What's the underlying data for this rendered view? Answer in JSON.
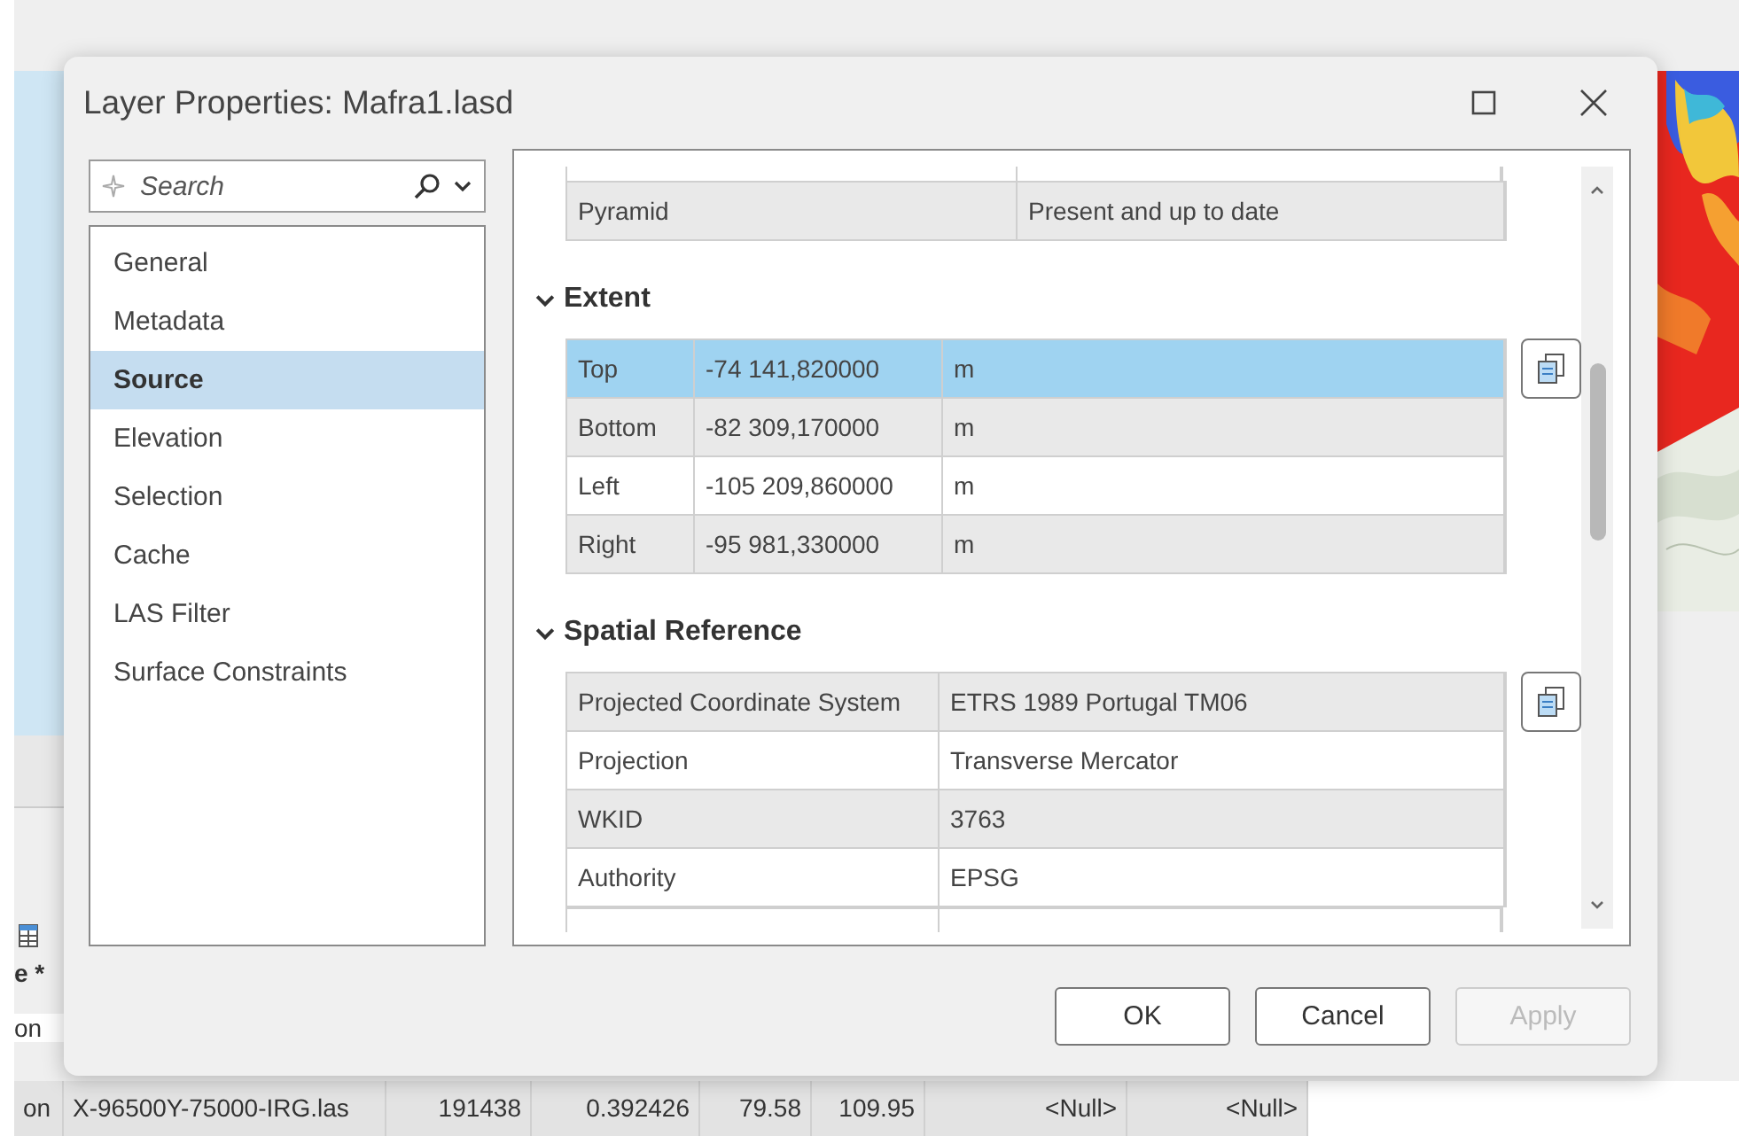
{
  "background": {
    "column_header": "e *",
    "row_label": "on",
    "table_row": [
      "on",
      "X-96500Y-75000-IRG.las",
      "191438",
      "0.392426",
      "79.58",
      "109.95",
      "<Null>",
      "<Null>"
    ]
  },
  "dialog": {
    "title": "Layer Properties: Mafra1.lasd",
    "search": {
      "placeholder": "Search"
    },
    "nav_items": [
      {
        "label": "General",
        "selected": false
      },
      {
        "label": "Metadata",
        "selected": false
      },
      {
        "label": "Source",
        "selected": true
      },
      {
        "label": "Elevation",
        "selected": false
      },
      {
        "label": "Selection",
        "selected": false
      },
      {
        "label": "Cache",
        "selected": false
      },
      {
        "label": "LAS Filter",
        "selected": false
      },
      {
        "label": "Surface Constraints",
        "selected": false
      }
    ],
    "top_table": {
      "rows": [
        {
          "cells": [
            "Pyramid",
            "Present and up to date"
          ],
          "selected": false
        }
      ]
    },
    "sections": [
      {
        "title": "Extent",
        "expanded": true,
        "kind": "extent",
        "rows": [
          {
            "cells": [
              "Top",
              "-74 141,820000",
              "m"
            ],
            "selected": true
          },
          {
            "cells": [
              "Bottom",
              "-82 309,170000",
              "m"
            ],
            "selected": false
          },
          {
            "cells": [
              "Left",
              "-105 209,860000",
              "m"
            ],
            "selected": false
          },
          {
            "cells": [
              "Right",
              "-95 981,330000",
              "m"
            ],
            "selected": false
          }
        ]
      },
      {
        "title": "Spatial Reference",
        "expanded": true,
        "kind": "reference",
        "rows": [
          {
            "cells": [
              "Projected Coordinate System",
              "ETRS 1989 Portugal TM06"
            ],
            "selected": false
          },
          {
            "cells": [
              "Projection",
              "Transverse Mercator"
            ],
            "selected": false
          },
          {
            "cells": [
              "WKID",
              "3763"
            ],
            "selected": false
          },
          {
            "cells": [
              "Authority",
              "EPSG"
            ],
            "selected": false
          }
        ]
      }
    ],
    "buttons": [
      {
        "label": "OK",
        "disabled": false
      },
      {
        "label": "Cancel",
        "disabled": false
      },
      {
        "label": "Apply",
        "disabled": true
      }
    ]
  }
}
